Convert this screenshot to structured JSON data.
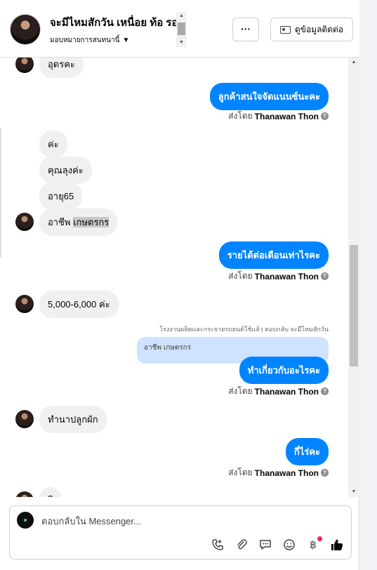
{
  "header": {
    "name": "จะมีไหมสักวัน เหนื่อย ท้อ รอ",
    "assign_label": "มอบหมายการสนทนานี้",
    "more_label": "···",
    "contact_label": "ดูข้อมูลติดต่อ"
  },
  "messages": {
    "m0": "อุดรคะ",
    "m1": "ลูกค้าสนใจจัดแนนซ์นะคะ",
    "sent_prefix": "ส่งโดย",
    "sender": "Thanawan Thon",
    "m2": "ค่ะ",
    "m3": "คุณลุงค่ะ",
    "m4": "อายุ65",
    "m5a": "อาชีพ ",
    "m5b": "เกษตรกร",
    "m6": "รายได้ต่อเดือนเท่าไรคะ",
    "m7": "5,000-6,000 ค่ะ",
    "reply_meta": "โรงงานผลิตและกระจายรถยนต์ใช้แล้ว ตอบกลับ จะมีไหมสักวัน",
    "quoted": "อาชีพ เกษตรกร",
    "m8": "ทำเกี่ยวกับอะไรคะ",
    "m9": "ทำนาปลูกผัก",
    "m10": "กี่ไร่คะ",
    "m11": "?"
  },
  "composer": {
    "placeholder": "ตอบกลับใน Messenger..."
  },
  "icons": {
    "more": "ellipsis-icon",
    "contact": "contact-card-icon",
    "call": "phone-add-icon",
    "attach": "paperclip-icon",
    "saved_reply": "chat-bubble-icon",
    "emoji": "smiley-icon",
    "payment": "baht-icon",
    "like": "thumbs-up-icon"
  },
  "colors": {
    "accent": "#0084ff",
    "incoming_bg": "#f0f0f0",
    "quoted_bg": "#cfe2ff"
  }
}
